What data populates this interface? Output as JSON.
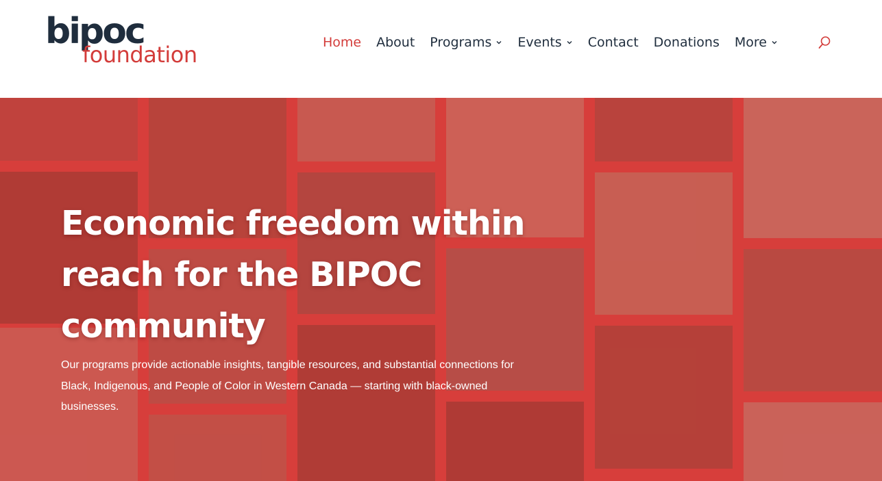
{
  "logo": {
    "line1": "bipoc",
    "line2": "foundation"
  },
  "nav": {
    "home": "Home",
    "about": "About",
    "programs": "Programs",
    "events": "Events",
    "contact": "Contact",
    "donations": "Donations",
    "more": "More"
  },
  "icons": {
    "search": "search-icon",
    "dropdown": "chevron-down-icon"
  },
  "colors": {
    "brand_red": "#d33c3a",
    "brand_navy": "#1f2d3d",
    "hero_overlay": "#d8403d"
  },
  "hero": {
    "title": "Economic freedom within reach for the BIPOC community",
    "text": "Our programs provide actionable insights, tangible resources, and substantial connections for Black, Indigenous, and People of Color in Western Canada — starting with black-owned businesses."
  }
}
